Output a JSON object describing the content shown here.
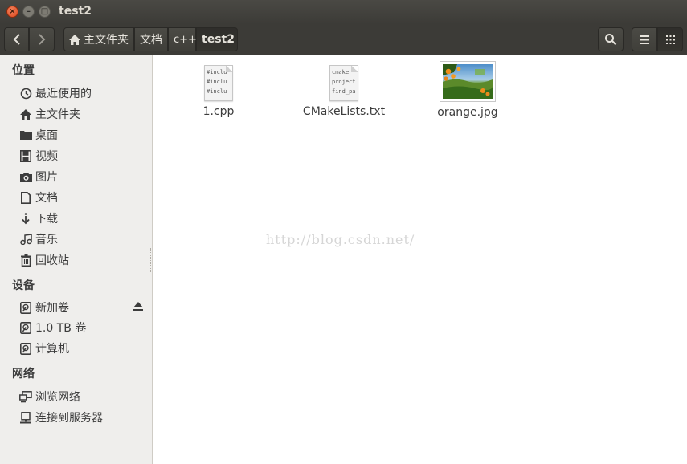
{
  "window": {
    "title": "test2",
    "buttons": {
      "close": "×",
      "minimize": "–",
      "maximize": "□"
    }
  },
  "toolbar": {
    "breadcrumbs": [
      {
        "label": "主文件夹",
        "icon": "home-icon"
      },
      {
        "label": "文档"
      },
      {
        "label": "c++"
      },
      {
        "label": "test2",
        "active": true
      }
    ],
    "icons": [
      "back-icon",
      "forward-icon",
      "search-icon",
      "list-view-icon",
      "grid-view-icon"
    ]
  },
  "sidebar": {
    "sections": {
      "places": "位置",
      "devices": "设备",
      "network": "网络"
    },
    "places": [
      {
        "label": "最近使用的",
        "icon": "clock-icon"
      },
      {
        "label": "主文件夹",
        "icon": "home-icon"
      },
      {
        "label": "桌面",
        "icon": "folder-icon"
      },
      {
        "label": "视频",
        "icon": "film-icon"
      },
      {
        "label": "图片",
        "icon": "camera-icon"
      },
      {
        "label": "文档",
        "icon": "document-icon"
      },
      {
        "label": "下载",
        "icon": "download-icon"
      },
      {
        "label": "音乐",
        "icon": "music-icon"
      },
      {
        "label": "回收站",
        "icon": "trash-icon"
      }
    ],
    "devices": [
      {
        "label": "新加卷",
        "icon": "drive-icon"
      },
      {
        "label": "1.0 TB 卷",
        "icon": "drive-icon"
      },
      {
        "label": "计算机",
        "icon": "drive-icon"
      }
    ],
    "network": [
      {
        "label": "浏览网络",
        "icon": "network-icon"
      },
      {
        "label": "连接到服务器",
        "icon": "server-icon"
      }
    ]
  },
  "files": [
    {
      "name": "1.cpp",
      "type": "text",
      "preview": [
        "#inclu",
        "#inclu",
        "#inclu"
      ]
    },
    {
      "name": "CMakeLists.txt",
      "type": "text",
      "preview": [
        "cmake_",
        "project",
        "find_pa"
      ]
    },
    {
      "name": "orange.jpg",
      "type": "image"
    }
  ],
  "watermark": "http://blog.csdn.net/",
  "colors": {
    "titlebar": "#3c3b37",
    "close_button": "#e05a2b",
    "sidebar": "#efeeec",
    "content": "#ffffff"
  }
}
